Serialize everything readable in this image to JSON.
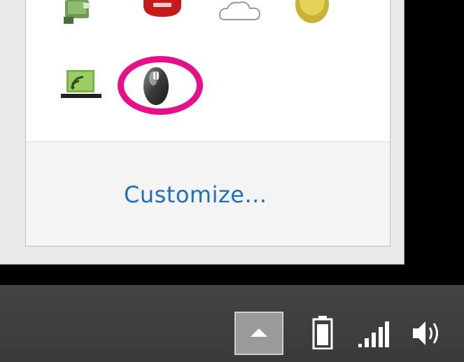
{
  "flyout": {
    "customize_label": "Customize...",
    "icons_row1": [
      "green-device-icon",
      "red-badge-icon",
      "cloud-icon",
      "yellow-circle-icon"
    ],
    "icons_row2": [
      "wireless-display-icon",
      "mouse-icon"
    ]
  },
  "taskbar": {
    "overflow_button_icon": "chevron-up-icon",
    "tray_icons": [
      "battery-icon",
      "signal-strength-icon",
      "speaker-icon"
    ]
  },
  "colors": {
    "highlight": "#e8108a",
    "link": "#1e6fc2",
    "taskbar": "#3f3f3f"
  }
}
